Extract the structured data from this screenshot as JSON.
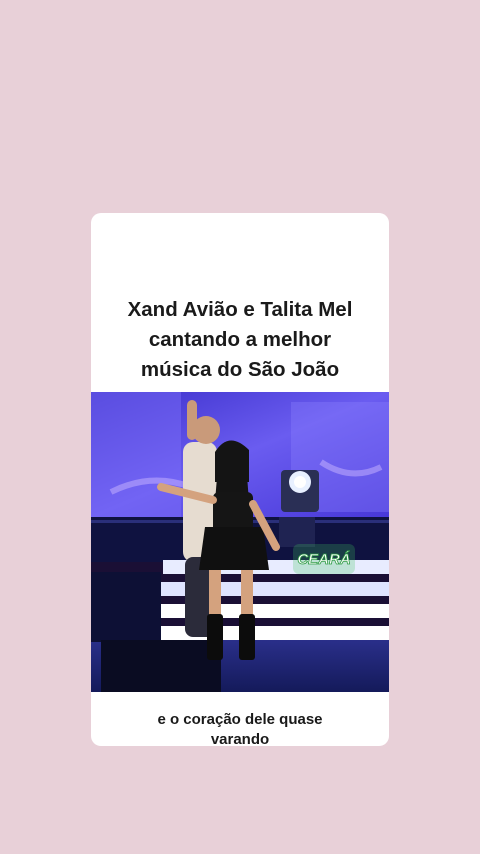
{
  "post": {
    "title": "Xand Avião e Talita Mel\ncantando a melhor\nmúsica do São João",
    "watermark": "CEARÁ",
    "caption": "e o coração dele quase\nvarando"
  },
  "colors": {
    "page_background": "#e8d0d8",
    "card_background": "#ffffff",
    "text": "#1a1a1a",
    "stage_screen": "#5a4fe0",
    "watermark_green": "#3fc35a"
  }
}
